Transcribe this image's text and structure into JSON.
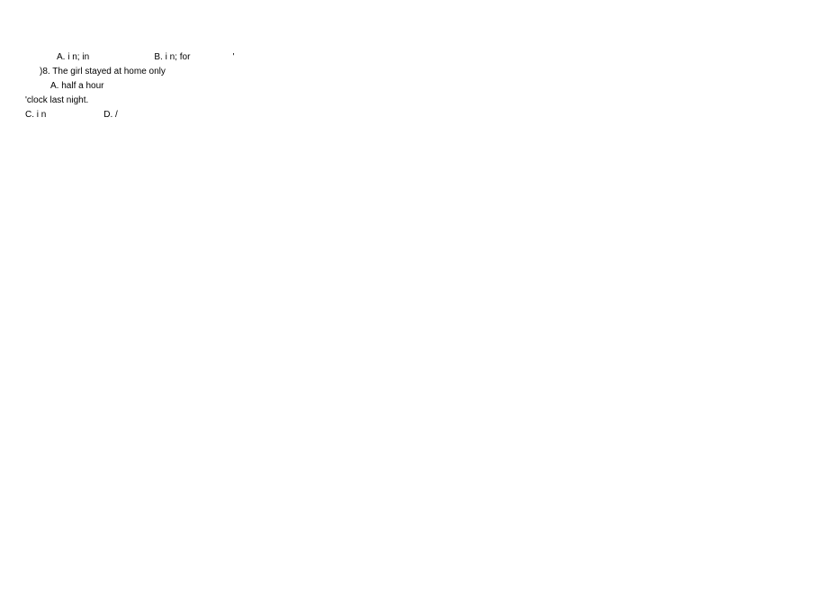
{
  "lines": {
    "line1_a": "A. i n; in",
    "line1_b": "B. i n; for",
    "line1_apostrophe": "'",
    "line2": ")8. The girl stayed at home only",
    "line3": "A. half a hour",
    "line4": "'clock last night.",
    "line5_c": "C. i n",
    "line5_d": "D. /"
  }
}
